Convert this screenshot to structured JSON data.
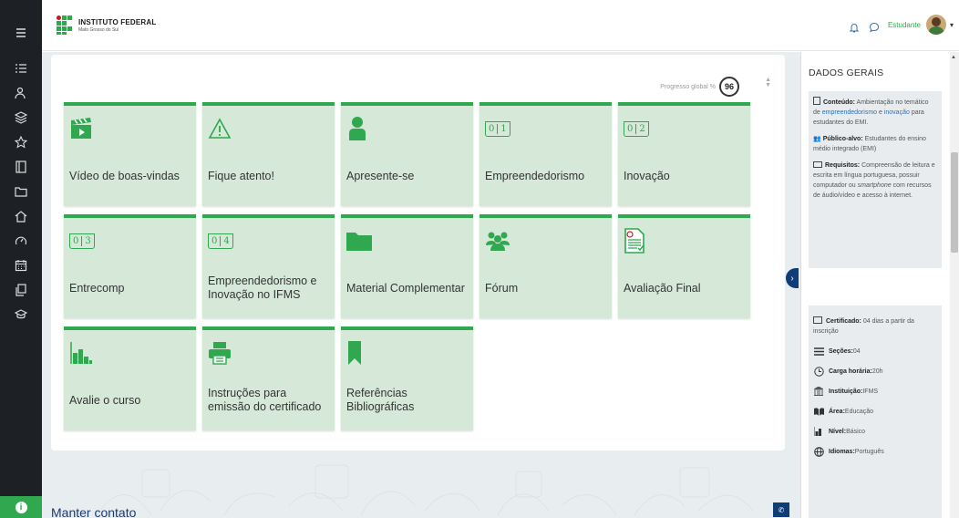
{
  "brand": {
    "name": "INSTITUTO FEDERAL",
    "sub": "Mato Grosso do Sul",
    "green": "#2fa84f",
    "red": "#c8191f"
  },
  "header": {
    "user": "Estudante"
  },
  "rail": {
    "icons": [
      "menu-icon",
      "list-icon",
      "participants-icon",
      "layers-icon",
      "star-icon",
      "book-icon",
      "folder-icon",
      "home-icon",
      "dashboard-icon",
      "calendar-icon",
      "copy-icon",
      "graduation-icon"
    ]
  },
  "progress": {
    "label": "Progresso global %",
    "value": "96"
  },
  "tiles": [
    {
      "label": "Vídeo de boas-vindas",
      "icon": "video-clapper-icon"
    },
    {
      "label": "Fique atento!",
      "icon": "warning-icon"
    },
    {
      "label": "Apresente-se",
      "icon": "person-icon"
    },
    {
      "label": "Empreendedorismo",
      "icon": "book-01-icon",
      "n1": "0",
      "n2": "1"
    },
    {
      "label": "Inovação",
      "icon": "book-02-icon",
      "n1": "0",
      "n2": "2"
    },
    {
      "label": "Entrecomp",
      "icon": "book-03-icon",
      "n1": "0",
      "n2": "3"
    },
    {
      "label": "Empreendedorismo e Inovação no IFMS",
      "icon": "book-04-icon",
      "n1": "0",
      "n2": "4"
    },
    {
      "label": "Material Complementar",
      "icon": "folder-icon"
    },
    {
      "label": "Fórum",
      "icon": "group-icon"
    },
    {
      "label": "Avaliação Final",
      "icon": "document-check-icon"
    },
    {
      "label": "Avalie o curso",
      "icon": "bar-chart-icon"
    },
    {
      "label": "Instruções para emissão do certificado",
      "icon": "printer-icon"
    },
    {
      "label": "Referências Bibliográficas",
      "icon": "bookmark-icon"
    }
  ],
  "footer": {
    "title": "Manter contato"
  },
  "drawer": {
    "title": "DADOS GERAIS",
    "conteudo": {
      "label": "Conteúdo:",
      "t1": " Ambientação no temático de ",
      "link1": "empreendedorismo",
      "t2": " e ",
      "link2": "inovação",
      "t3": " para estudantes do EMI."
    },
    "publico": {
      "label": "Público-alvo:",
      "text": " Estudantes do ensino médio integrado (EMI)"
    },
    "requisitos": {
      "label": "Requisitos:",
      "t1": " Compreensão de leitura e escrita em língua portuguesa, possuir computador ou ",
      "em": "smartphone",
      "t2": " com recursos de áudio/vídeo e acesso à internet."
    },
    "certificado": {
      "label": "Certificado:",
      "text": " 04 dias a partir da inscrição"
    },
    "secoes": {
      "label": "Seções:",
      "text": " 04"
    },
    "carga": {
      "label": "Carga horária:",
      "text": " 20h"
    },
    "instituicao": {
      "label": "Instituição:",
      "text": " IFMS"
    },
    "area": {
      "label": "Área:",
      "text": " Educação"
    },
    "nivel": {
      "label": "Nível:",
      "text": " Básico"
    },
    "idiomas": {
      "label": "Idiomas:",
      "text": " Português"
    }
  }
}
